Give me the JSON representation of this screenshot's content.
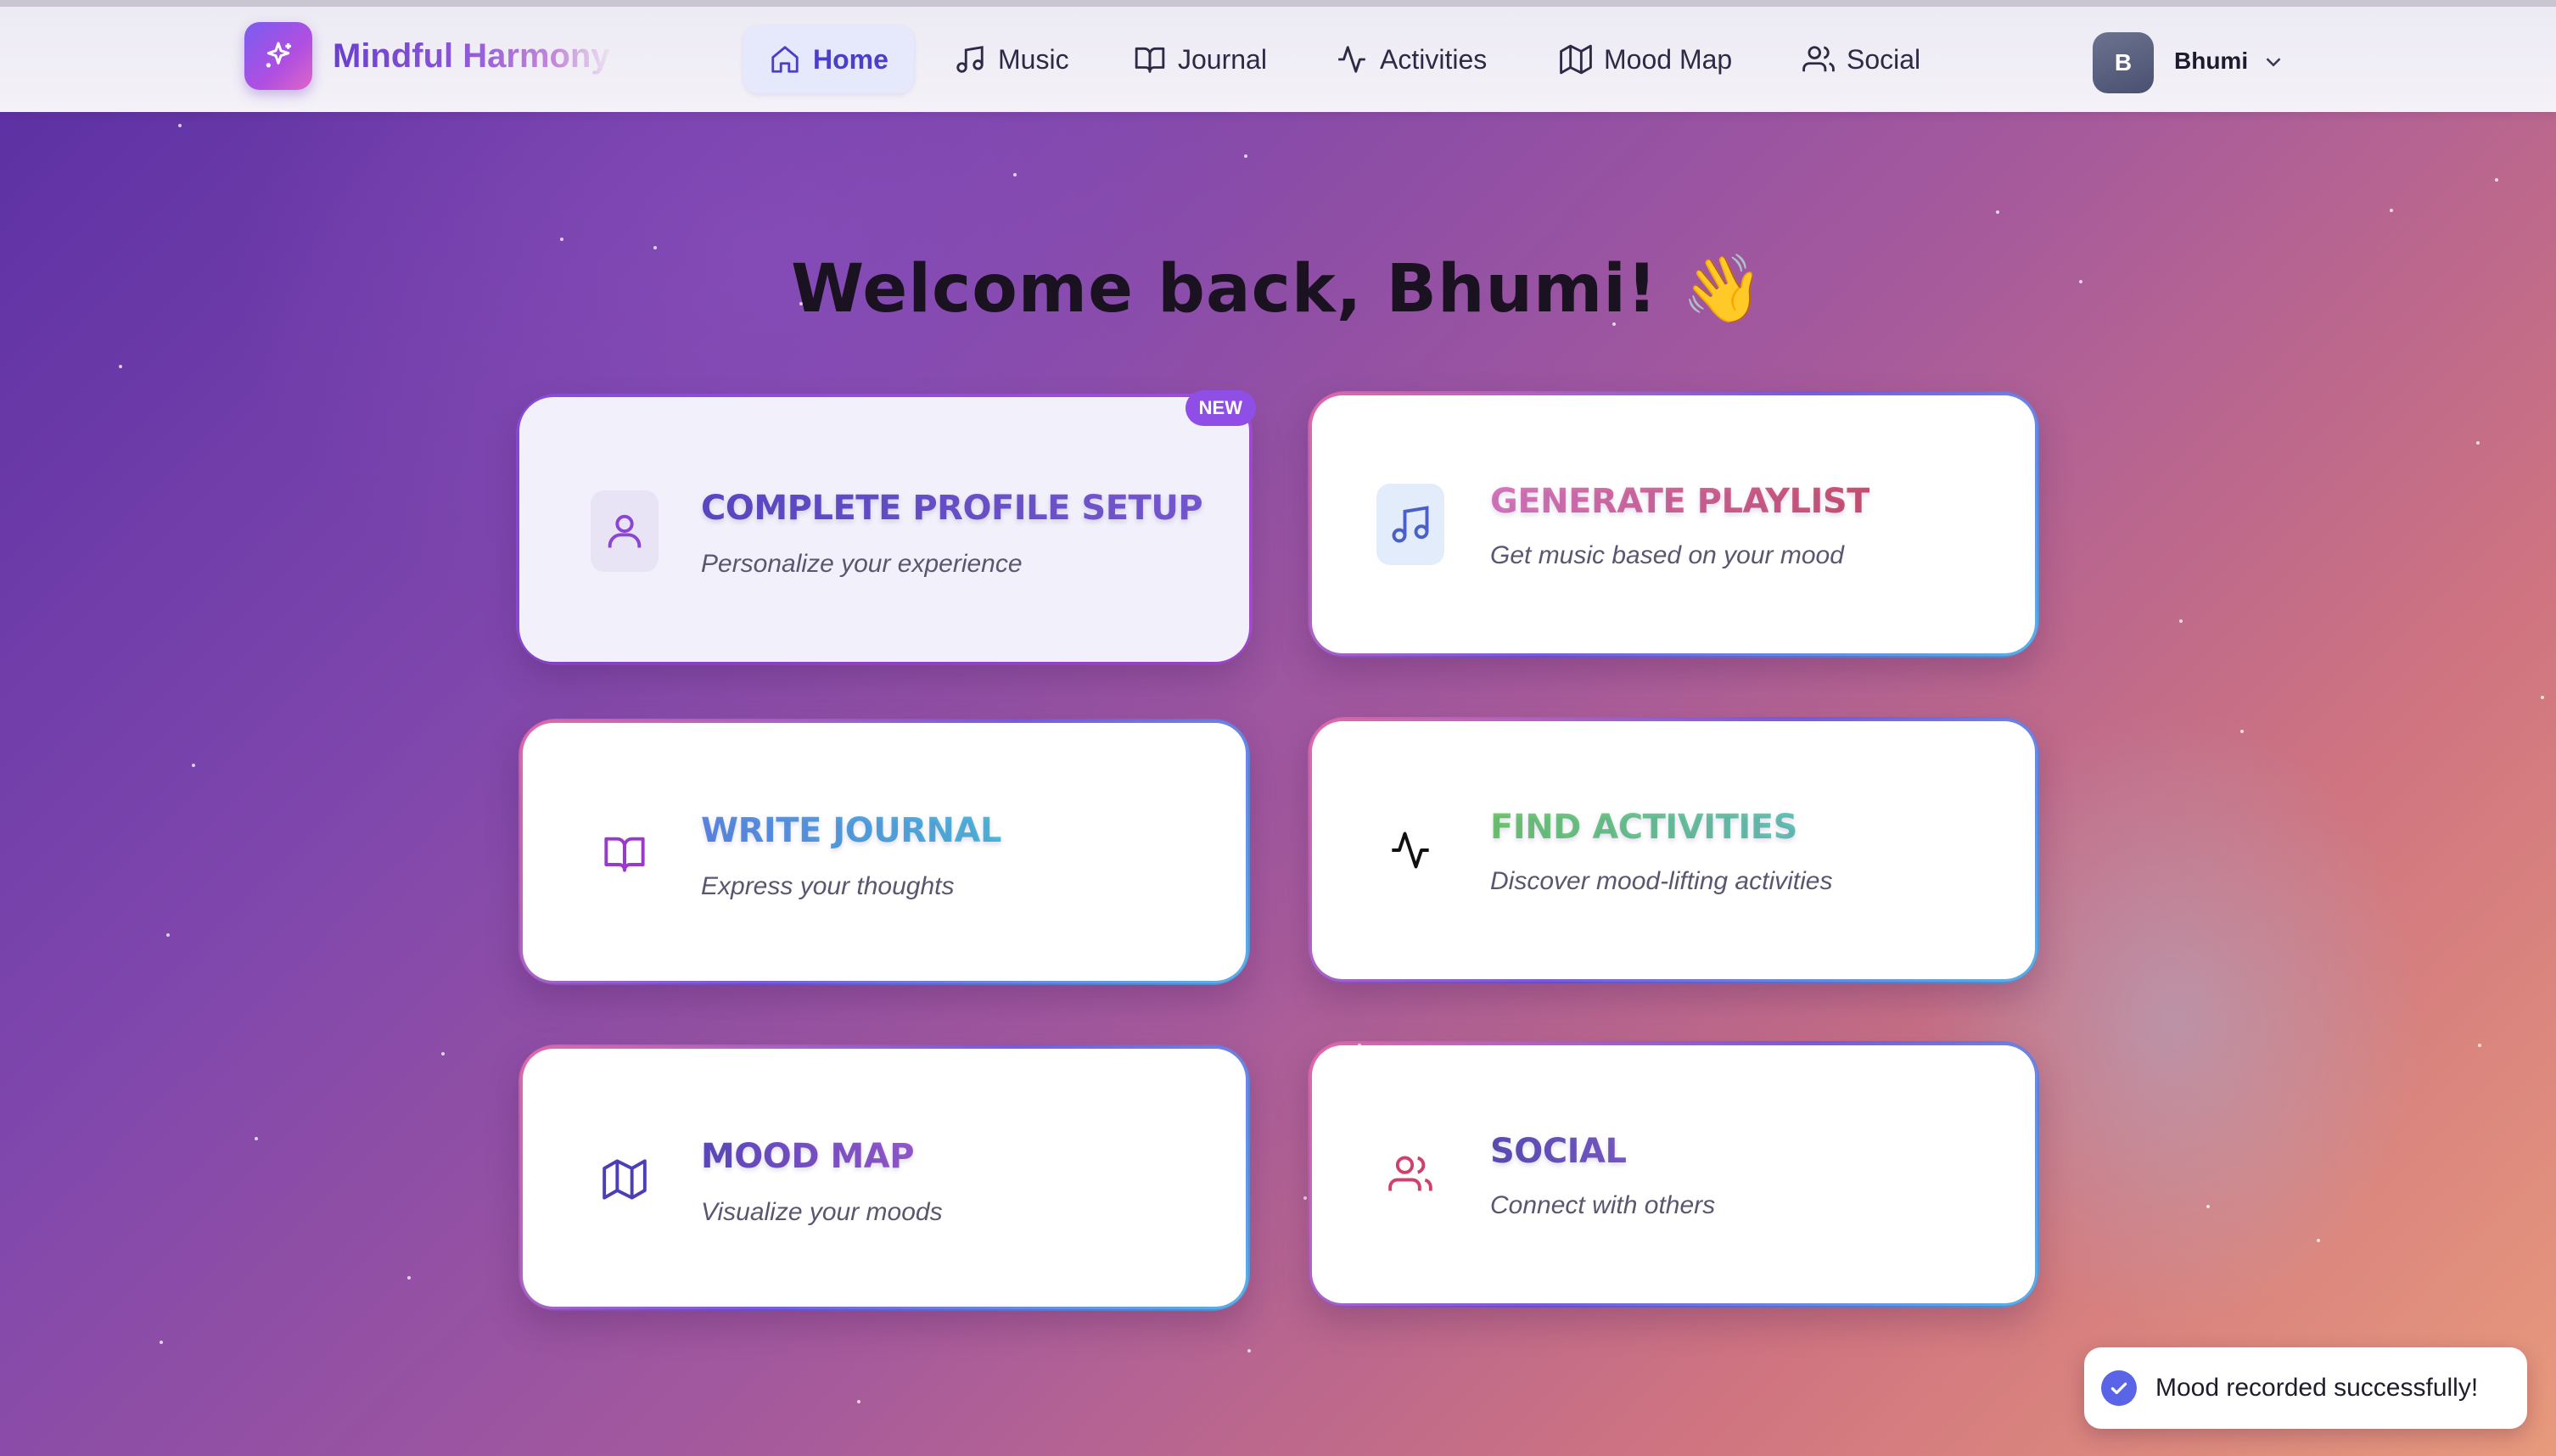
{
  "app": {
    "name": "Mindful Harmony",
    "logo_icon": "sparkles-icon"
  },
  "nav": {
    "items": [
      {
        "label": "Home",
        "icon": "home-icon",
        "active": true
      },
      {
        "label": "Music",
        "icon": "music-icon"
      },
      {
        "label": "Journal",
        "icon": "book-icon"
      },
      {
        "label": "Activities",
        "icon": "activity-icon"
      },
      {
        "label": "Mood Map",
        "icon": "map-icon"
      },
      {
        "label": "Social",
        "icon": "users-icon"
      }
    ],
    "user": {
      "initial": "B",
      "name": "Bhumi"
    }
  },
  "main": {
    "welcome": "Welcome back, Bhumi! 👋",
    "cards": [
      {
        "title": "COMPLETE PROFILE SETUP",
        "subtitle": "Personalize your experience",
        "icon": "user-icon",
        "badge": "NEW"
      },
      {
        "title": "GENERATE PLAYLIST",
        "subtitle": "Get music based on your mood",
        "icon": "music-icon"
      },
      {
        "title": "WRITE JOURNAL",
        "subtitle": "Express your thoughts",
        "icon": "book-icon"
      },
      {
        "title": "FIND ACTIVITIES",
        "subtitle": "Discover mood-lifting activities",
        "icon": "activity-icon"
      },
      {
        "title": "MOOD MAP",
        "subtitle": "Visualize your moods",
        "icon": "map-icon"
      },
      {
        "title": "SOCIAL",
        "subtitle": "Connect with others",
        "icon": "users-icon"
      }
    ]
  },
  "toast": {
    "message": "Mood recorded successfully!",
    "icon": "check-circle-icon"
  },
  "colors": {
    "accent": "#4b3fc9",
    "badge": "#8f4fe6",
    "toast_check": "#5a64e6"
  }
}
